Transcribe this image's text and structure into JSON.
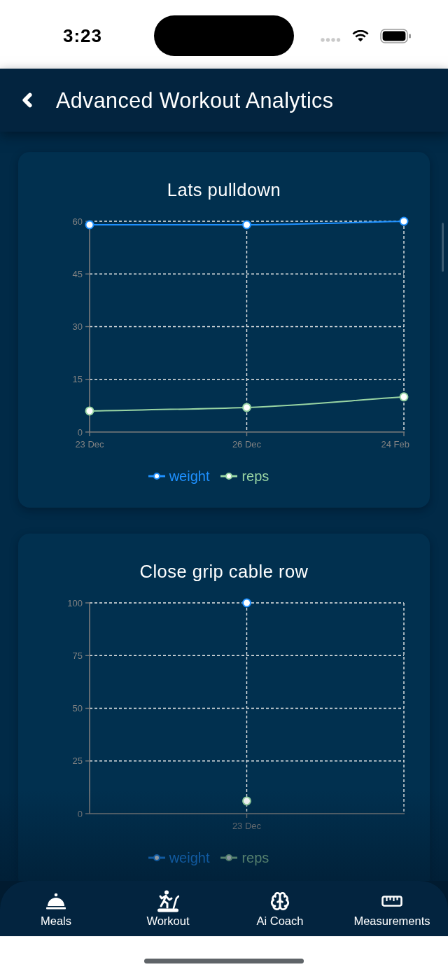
{
  "status_bar": {
    "time": "3:23"
  },
  "header": {
    "title": "Advanced Workout Analytics"
  },
  "charts": [
    {
      "chart_data": {
        "type": "line",
        "title": "Lats pulldown",
        "categories": [
          "23 Dec",
          "26 Dec",
          "24 Feb"
        ],
        "series": [
          {
            "name": "weight",
            "color": "#1e90ff",
            "marker": "circle",
            "values": [
              59,
              59,
              60
            ]
          },
          {
            "name": "reps",
            "color": "#98d4a3",
            "marker": "circle",
            "values": [
              6,
              7,
              10
            ]
          }
        ],
        "ylim": [
          0,
          60
        ],
        "yticks": [
          0,
          15,
          30,
          45,
          60
        ],
        "grid": true,
        "legend": "bottom"
      }
    },
    {
      "chart_data": {
        "type": "line",
        "title": "Close grip cable row",
        "categories": [
          "23 Dec"
        ],
        "series": [
          {
            "name": "weight",
            "color": "#1e90ff",
            "marker": "circle",
            "values": [
              100
            ]
          },
          {
            "name": "reps",
            "color": "#98d4a3",
            "marker": "circle",
            "values": [
              6
            ]
          }
        ],
        "ylim": [
          0,
          100
        ],
        "yticks": [
          0,
          25,
          50,
          75,
          100
        ],
        "grid": true,
        "legend": "bottom"
      }
    }
  ],
  "tab_bar": {
    "tabs": [
      {
        "label": "Meals"
      },
      {
        "label": "Workout"
      },
      {
        "label": "Ai Coach"
      },
      {
        "label": "Measurements"
      }
    ]
  }
}
